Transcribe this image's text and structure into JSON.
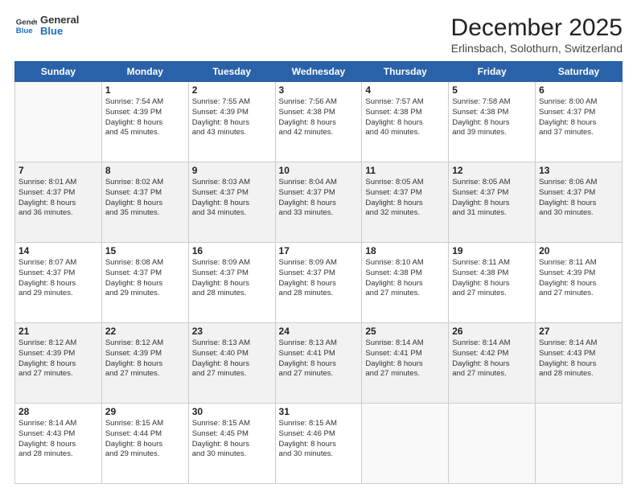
{
  "header": {
    "logo_line1": "General",
    "logo_line2": "Blue",
    "title": "December 2025",
    "subtitle": "Erlinsbach, Solothurn, Switzerland"
  },
  "days_of_week": [
    "Sunday",
    "Monday",
    "Tuesday",
    "Wednesday",
    "Thursday",
    "Friday",
    "Saturday"
  ],
  "weeks": [
    [
      {
        "day": "",
        "info": ""
      },
      {
        "day": "1",
        "info": "Sunrise: 7:54 AM\nSunset: 4:39 PM\nDaylight: 8 hours\nand 45 minutes."
      },
      {
        "day": "2",
        "info": "Sunrise: 7:55 AM\nSunset: 4:39 PM\nDaylight: 8 hours\nand 43 minutes."
      },
      {
        "day": "3",
        "info": "Sunrise: 7:56 AM\nSunset: 4:38 PM\nDaylight: 8 hours\nand 42 minutes."
      },
      {
        "day": "4",
        "info": "Sunrise: 7:57 AM\nSunset: 4:38 PM\nDaylight: 8 hours\nand 40 minutes."
      },
      {
        "day": "5",
        "info": "Sunrise: 7:58 AM\nSunset: 4:38 PM\nDaylight: 8 hours\nand 39 minutes."
      },
      {
        "day": "6",
        "info": "Sunrise: 8:00 AM\nSunset: 4:37 PM\nDaylight: 8 hours\nand 37 minutes."
      }
    ],
    [
      {
        "day": "7",
        "info": "Sunrise: 8:01 AM\nSunset: 4:37 PM\nDaylight: 8 hours\nand 36 minutes."
      },
      {
        "day": "8",
        "info": "Sunrise: 8:02 AM\nSunset: 4:37 PM\nDaylight: 8 hours\nand 35 minutes."
      },
      {
        "day": "9",
        "info": "Sunrise: 8:03 AM\nSunset: 4:37 PM\nDaylight: 8 hours\nand 34 minutes."
      },
      {
        "day": "10",
        "info": "Sunrise: 8:04 AM\nSunset: 4:37 PM\nDaylight: 8 hours\nand 33 minutes."
      },
      {
        "day": "11",
        "info": "Sunrise: 8:05 AM\nSunset: 4:37 PM\nDaylight: 8 hours\nand 32 minutes."
      },
      {
        "day": "12",
        "info": "Sunrise: 8:05 AM\nSunset: 4:37 PM\nDaylight: 8 hours\nand 31 minutes."
      },
      {
        "day": "13",
        "info": "Sunrise: 8:06 AM\nSunset: 4:37 PM\nDaylight: 8 hours\nand 30 minutes."
      }
    ],
    [
      {
        "day": "14",
        "info": "Sunrise: 8:07 AM\nSunset: 4:37 PM\nDaylight: 8 hours\nand 29 minutes."
      },
      {
        "day": "15",
        "info": "Sunrise: 8:08 AM\nSunset: 4:37 PM\nDaylight: 8 hours\nand 29 minutes."
      },
      {
        "day": "16",
        "info": "Sunrise: 8:09 AM\nSunset: 4:37 PM\nDaylight: 8 hours\nand 28 minutes."
      },
      {
        "day": "17",
        "info": "Sunrise: 8:09 AM\nSunset: 4:37 PM\nDaylight: 8 hours\nand 28 minutes."
      },
      {
        "day": "18",
        "info": "Sunrise: 8:10 AM\nSunset: 4:38 PM\nDaylight: 8 hours\nand 27 minutes."
      },
      {
        "day": "19",
        "info": "Sunrise: 8:11 AM\nSunset: 4:38 PM\nDaylight: 8 hours\nand 27 minutes."
      },
      {
        "day": "20",
        "info": "Sunrise: 8:11 AM\nSunset: 4:39 PM\nDaylight: 8 hours\nand 27 minutes."
      }
    ],
    [
      {
        "day": "21",
        "info": "Sunrise: 8:12 AM\nSunset: 4:39 PM\nDaylight: 8 hours\nand 27 minutes."
      },
      {
        "day": "22",
        "info": "Sunrise: 8:12 AM\nSunset: 4:39 PM\nDaylight: 8 hours\nand 27 minutes."
      },
      {
        "day": "23",
        "info": "Sunrise: 8:13 AM\nSunset: 4:40 PM\nDaylight: 8 hours\nand 27 minutes."
      },
      {
        "day": "24",
        "info": "Sunrise: 8:13 AM\nSunset: 4:41 PM\nDaylight: 8 hours\nand 27 minutes."
      },
      {
        "day": "25",
        "info": "Sunrise: 8:14 AM\nSunset: 4:41 PM\nDaylight: 8 hours\nand 27 minutes."
      },
      {
        "day": "26",
        "info": "Sunrise: 8:14 AM\nSunset: 4:42 PM\nDaylight: 8 hours\nand 27 minutes."
      },
      {
        "day": "27",
        "info": "Sunrise: 8:14 AM\nSunset: 4:43 PM\nDaylight: 8 hours\nand 28 minutes."
      }
    ],
    [
      {
        "day": "28",
        "info": "Sunrise: 8:14 AM\nSunset: 4:43 PM\nDaylight: 8 hours\nand 28 minutes."
      },
      {
        "day": "29",
        "info": "Sunrise: 8:15 AM\nSunset: 4:44 PM\nDaylight: 8 hours\nand 29 minutes."
      },
      {
        "day": "30",
        "info": "Sunrise: 8:15 AM\nSunset: 4:45 PM\nDaylight: 8 hours\nand 30 minutes."
      },
      {
        "day": "31",
        "info": "Sunrise: 8:15 AM\nSunset: 4:46 PM\nDaylight: 8 hours\nand 30 minutes."
      },
      {
        "day": "",
        "info": ""
      },
      {
        "day": "",
        "info": ""
      },
      {
        "day": "",
        "info": ""
      }
    ]
  ]
}
